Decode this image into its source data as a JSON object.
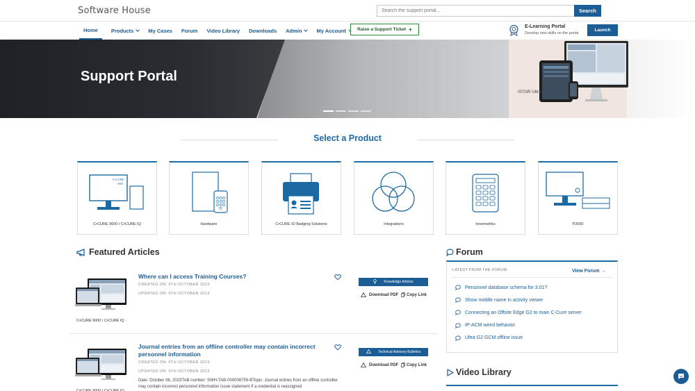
{
  "header": {
    "logo": "Software House",
    "search_placeholder": "Search the support portal...",
    "search_button": "Search"
  },
  "nav": {
    "items": [
      {
        "label": "Home",
        "active": true,
        "dropdown": false
      },
      {
        "label": "Products",
        "active": false,
        "dropdown": true
      },
      {
        "label": "My Cases",
        "active": false,
        "dropdown": false
      },
      {
        "label": "Forum",
        "active": false,
        "dropdown": false
      },
      {
        "label": "Video Library",
        "active": false,
        "dropdown": false
      },
      {
        "label": "Downloads",
        "active": false,
        "dropdown": false
      },
      {
        "label": "Admin",
        "active": false,
        "dropdown": true
      },
      {
        "label": "My Account",
        "active": false,
        "dropdown": true
      }
    ],
    "raise_ticket": "Raise a Support Ticket",
    "raise_ticket_icon": "+",
    "elearning_title": "E-Learning Portal",
    "elearning_sub": "Develop new skills on the portal",
    "launch": "Launch"
  },
  "hero": {
    "title": "Support Portal",
    "image_caption": "iSTAR Ultra",
    "carousel_slides": 4,
    "carousel_active": 0
  },
  "products": {
    "title": "Select a Product",
    "items": [
      {
        "label": "C•CURE 9000 / C•CURE IQ",
        "icon": "monitor-tower-icon",
        "art_text": "C•CURE 9000"
      },
      {
        "label": "Hardware",
        "icon": "panel-keypad-icon"
      },
      {
        "label": "C•CURE ID Badging Solutions",
        "icon": "badge-printer-icon"
      },
      {
        "label": "Integrations",
        "icon": "venn-diagram-icon"
      },
      {
        "label": "Innometriks",
        "icon": "keypad-reader-icon"
      },
      {
        "label": "P2000",
        "icon": "monitor-server-icon"
      }
    ]
  },
  "featured": {
    "title": "Featured Articles",
    "articles": [
      {
        "title": "Where can I access Training Courses?",
        "created": "CREATED ON: 6TH OCTOBER 2023",
        "updated": "UPDATED ON: 6TH OCTOBER 2023",
        "category": "Knowledge Articles",
        "category_icon": "lightbulb-icon",
        "download": "Download PDF",
        "copy": "Copy Link",
        "product": "C•CURE 9000 / C•CURE IQ",
        "description": ""
      },
      {
        "title": "Journal entries from an offline controller may contain incorrect personnel information",
        "created": "CREATED ON: 6TH OCTOBER 2023",
        "updated": "UPDATED ON: 6TH OCTOBER 2023",
        "category": "Technical Advisory Bulletins",
        "category_icon": "warning-icon",
        "download": "Download PDF",
        "copy": "Copy Link",
        "product": "C•CURE 9000 / C•CURE IQ",
        "description": "Date: October 06, 2023TAB number: SWH-TAB-000036755-BTopic: Journal entries from an offline controller may contain incorrect personnel information Issue statement If a credential is reassigned"
      }
    ]
  },
  "forum": {
    "title": "Forum",
    "latest_label": "LATEST FROM THE FORUM",
    "view_forum": "View Forum →",
    "items": [
      "Personnel database schema for 3.01?",
      "Show middle name in activity viewer",
      "Connecting an Offsite Edge G2 to main C-Cure server",
      "IP-ACM weird behavior",
      "Ultra G2 GCM offline issue"
    ]
  },
  "video": {
    "title": "Video Library"
  },
  "colors": {
    "brand_blue": "#1c5d96",
    "accent_green": "#2a8a3c"
  }
}
